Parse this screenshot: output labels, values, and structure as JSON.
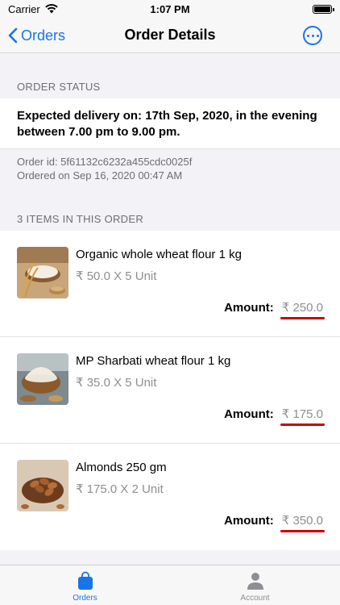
{
  "status_bar": {
    "carrier": "Carrier",
    "time": "1:07 PM"
  },
  "nav": {
    "back_label": "Orders",
    "title": "Order Details",
    "more_icon": "ellipsis-circle-icon"
  },
  "order_status": {
    "header": "ORDER STATUS",
    "message": "Expected delivery on: 17th Sep, 2020, in the evening between 7.00 pm to 9.00 pm.",
    "order_id": "Order id: 5f61132c6232a455cdc0025f",
    "ordered_on": "Ordered on Sep 16, 2020 00:47 AM"
  },
  "items_section": {
    "header": "3 ITEMS IN THIS ORDER",
    "amount_label": "Amount:",
    "items": [
      {
        "name": "Organic whole wheat flour 1 kg",
        "qty": "₹ 50.0 X 5 Unit",
        "amount": "₹ 250.0"
      },
      {
        "name": "MP Sharbati wheat flour 1 kg",
        "qty": "₹ 35.0 X 5 Unit",
        "amount": "₹ 175.0"
      },
      {
        "name": "Almonds 250 gm",
        "qty": "₹ 175.0 X 2 Unit",
        "amount": "₹ 350.0"
      }
    ]
  },
  "tab_bar": {
    "tabs": [
      {
        "label": "Orders",
        "icon": "bag-icon",
        "active": true
      },
      {
        "label": "Account",
        "icon": "person-icon",
        "active": false
      }
    ]
  },
  "colors": {
    "accent": "#1a73e8",
    "underline": "#cc0000"
  }
}
